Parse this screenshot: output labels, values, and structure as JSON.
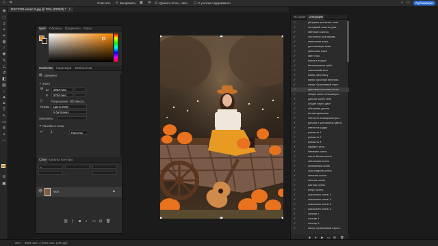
{
  "options_bar": {
    "items": [
      "Очистить",
      "Выпрямить",
      "Удалить отсеч. пикс.",
      "С учетом содержимого"
    ],
    "publish_label": "Публикация"
  },
  "document_tab": {
    "title": "DSC2725 копия 2.jpg @ 25% (RGB/8) *",
    "close": "×"
  },
  "color_panel": {
    "tabs": [
      "Цвет",
      "Образцы",
      "Градиенты",
      "Узоры"
    ],
    "accent": "#e8892a"
  },
  "properties_panel": {
    "tabs": [
      "Свойства",
      "Коррекция",
      "Библиотеки"
    ],
    "document_label": "Документ",
    "canvas_section": "Холст",
    "width_label": "Ш",
    "width_value": "3863 пикс.",
    "height_label": "В",
    "height_value": "5794 пикс.",
    "resolution": "Разрешение: 300 пикс/д...",
    "mode_label": "Режим",
    "mode_value": "Цвета RGB",
    "bits_value": "8 бит/канал",
    "fill_label": "Заполнить",
    "rulers_section": "Линейки и сетки",
    "units_value": "Пикселы"
  },
  "layers_panel": {
    "tabs": [
      "Слои",
      "Каналы",
      "Контуры"
    ],
    "layer_name": "Фон"
  },
  "history_panel": {
    "tabs": [
      "История",
      "Операции"
    ],
    "items": [
      "убираем желтизне тени",
      "холодный соксгоо для ...",
      "светлый соксгоо",
      "чистотное разглажив...",
      "смягчение кожи",
      "детализация кожи",
      "увеличим кожи",
      "свет глаз",
      "блеск в глазах",
      "белоснежные зубы",
      "тональный свет",
      "минус желтизну",
      "минус красный переизл...",
      "минус Оранжевый пере...",
      "красивая осенняя осень",
      "общие свято-темный ра...",
      "датали через тени",
      "общие через цвет",
      "объемная длина",
      "виньетирование",
      "Четкость в микроконтра...",
      "детали с усилением цвета",
      "светлота кадра",
      "резкость 1",
      "резкость 2",
      "резкость 3",
      "эффект зено",
      "бежевая осень",
      "пасто-белая осень",
      "занзновая осень",
      "оранжевая осень",
      "шоколадная осень",
      "зеленая осень",
      "желтая осень",
      "мятная осень",
      "ретро осень",
      "сказочная осень 1",
      "сказочная осень 2",
      "сказочная осень 3",
      "сказочная осень 4",
      "солнце 1",
      "солнце 2",
      "солнце 3",
      "минус Оранжевый перез..."
    ]
  },
  "status_bar": {
    "zoom": "25%",
    "doc_info": "3863 пикс. x 5794 пикс. (300 ppi)"
  }
}
